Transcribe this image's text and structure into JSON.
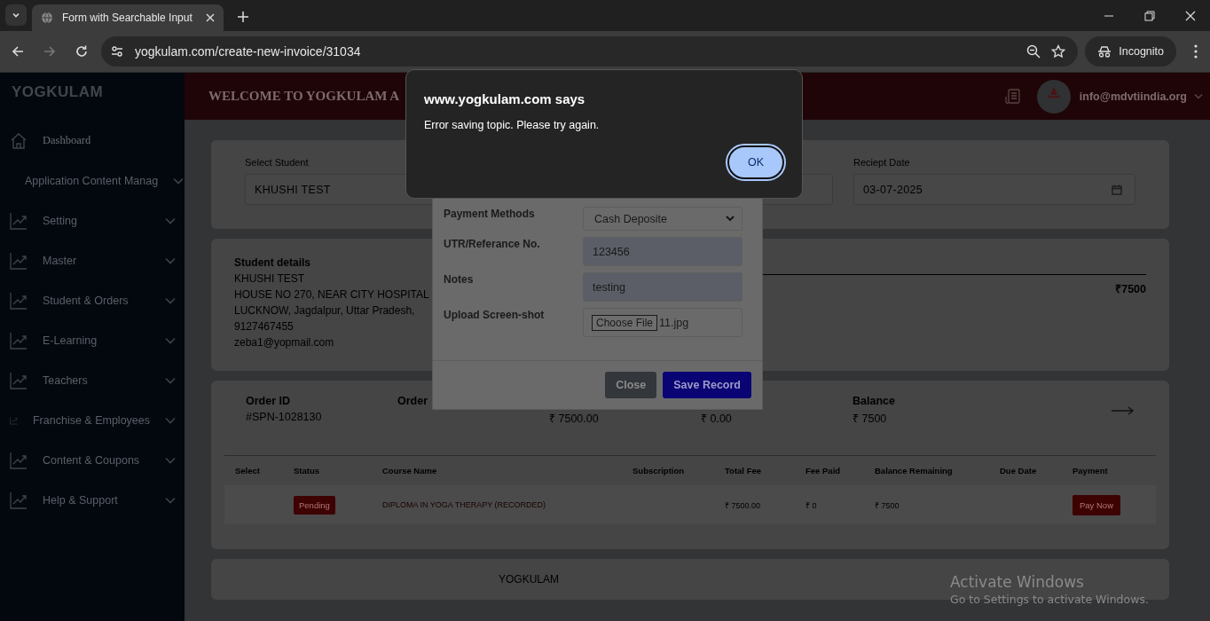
{
  "browser": {
    "tab_title": "Form with Searchable Input",
    "url": "yogkulam.com/create-new-invoice/31034",
    "profile": "Incognito",
    "forward_disabled": true
  },
  "sidebar": {
    "brand": "YOGKULAM",
    "items": [
      {
        "label": "Dashboard",
        "has_submenu": false,
        "selected": true
      },
      {
        "label": "Application Content Manag",
        "has_submenu": true,
        "selected": false
      },
      {
        "label": "Setting",
        "has_submenu": true,
        "selected": false
      },
      {
        "label": "Master",
        "has_submenu": true,
        "selected": false
      },
      {
        "label": "Student & Orders",
        "has_submenu": true,
        "selected": false
      },
      {
        "label": "E-Learning",
        "has_submenu": true,
        "selected": false
      },
      {
        "label": "Teachers",
        "has_submenu": true,
        "selected": false
      },
      {
        "label": "Franchise & Employees",
        "has_submenu": true,
        "selected": false
      },
      {
        "label": "Content & Coupons",
        "has_submenu": true,
        "selected": false
      },
      {
        "label": "Help & Support",
        "has_submenu": true,
        "selected": false
      }
    ]
  },
  "header": {
    "welcome": "WELCOME TO YOGKULAM A",
    "email": "info@mdvtiindia.org"
  },
  "invoice_form": {
    "fields": [
      {
        "kind": "text",
        "label": "Select Student",
        "value": "KHUSHI TEST"
      },
      {
        "kind": "text"
      },
      {
        "kind": "date",
        "label": "Reciept Date",
        "value": "03-07-2025"
      }
    ]
  },
  "student_details": {
    "title": "Student details",
    "lines": [
      "KHUSHI TEST",
      "HOUSE NO 270, NEAR CITY HOSPITAL",
      "LUCKNOW, Jagdalpur, Uttar Pradesh,",
      "9127467455",
      "zeba1@yopmail.com"
    ],
    "total": "₹7500"
  },
  "order": {
    "summary": [
      {
        "label": "Order ID",
        "value": "#SPN-1028130"
      },
      {
        "label": "Order"
      },
      {
        "value": "₹ 7500.00"
      },
      {
        "value": "₹ 0.00"
      },
      {
        "label": "Balance",
        "value": "₹ 7500"
      }
    ],
    "columns": [
      "Select",
      "Status",
      "Course Name",
      "Subscription",
      "Total Fee",
      "Fee Paid",
      "Balance Remaining",
      "Due Date",
      "Payment"
    ],
    "rows": [
      {
        "cells": [
          {
            "kind": "empty"
          },
          {
            "kind": "badge",
            "text": "Pending"
          },
          {
            "kind": "course",
            "text": "DIPLOMA IN YOGA THERAPY (RECORDED)"
          },
          {
            "kind": "empty"
          },
          {
            "kind": "text",
            "text": "₹ 7500.00"
          },
          {
            "kind": "text",
            "text": "₹ 0"
          },
          {
            "kind": "text",
            "text": "₹ 7500"
          },
          {
            "kind": "empty"
          },
          {
            "kind": "button",
            "text": "Pay Now"
          }
        ]
      }
    ]
  },
  "footer": {
    "brand": "YOGKULAM"
  },
  "payment_modal": {
    "fields": [
      {
        "kind": "select",
        "label": "Payment Methods",
        "value": "Cash Deposite"
      },
      {
        "kind": "input",
        "label": "UTR/Referance No.",
        "value": "123456"
      },
      {
        "kind": "input",
        "label": "Notes",
        "value": "testing"
      },
      {
        "kind": "file",
        "label": "Upload Screen-shot",
        "button": "Choose File",
        "value": "11.jpg"
      }
    ],
    "buttons": [
      {
        "kind": "secondary",
        "label": "Close"
      },
      {
        "kind": "primary",
        "label": "Save Record"
      }
    ]
  },
  "alert": {
    "title": "www.yogkulam.com says",
    "message": "Error saving topic. Please try again.",
    "button": "OK"
  },
  "os_notice": {
    "title": "Activate Windows",
    "message": "Go to Settings to activate Windows."
  }
}
